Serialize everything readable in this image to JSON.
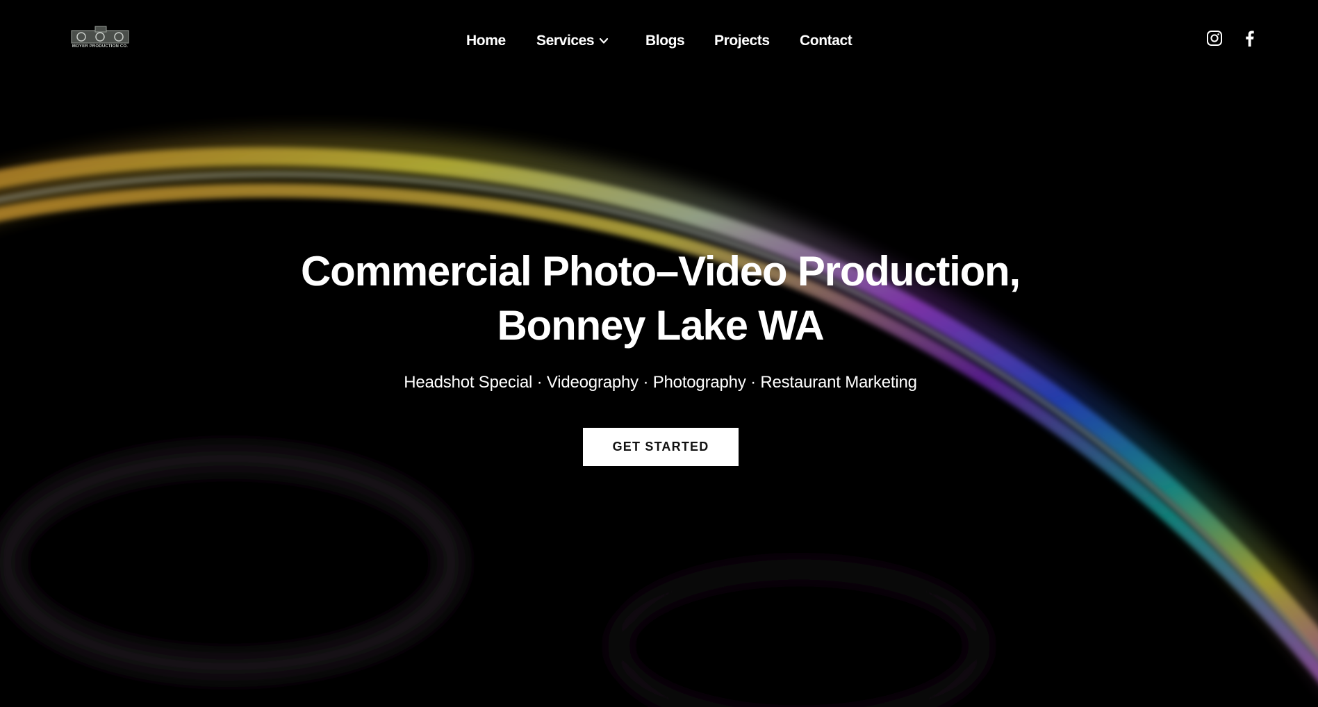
{
  "brand": {
    "logo_text": "MOYER PRODUCTION CO."
  },
  "nav": {
    "items": [
      {
        "label": "Home"
      },
      {
        "label": "Services"
      },
      {
        "label": "Blogs"
      },
      {
        "label": "Projects"
      },
      {
        "label": "Contact"
      }
    ]
  },
  "social": {
    "icons": [
      "instagram-icon",
      "facebook-icon"
    ]
  },
  "hero": {
    "title": "Commercial Photo–Video Production, Bonney Lake WA",
    "subtitle": "Headshot Special · Videography · Photography · Restaurant Marketing",
    "cta_label": "GET STARTED"
  },
  "colors": {
    "background": "#000000",
    "text": "#ffffff",
    "button_bg": "#ffffff",
    "button_text": "#111111"
  }
}
